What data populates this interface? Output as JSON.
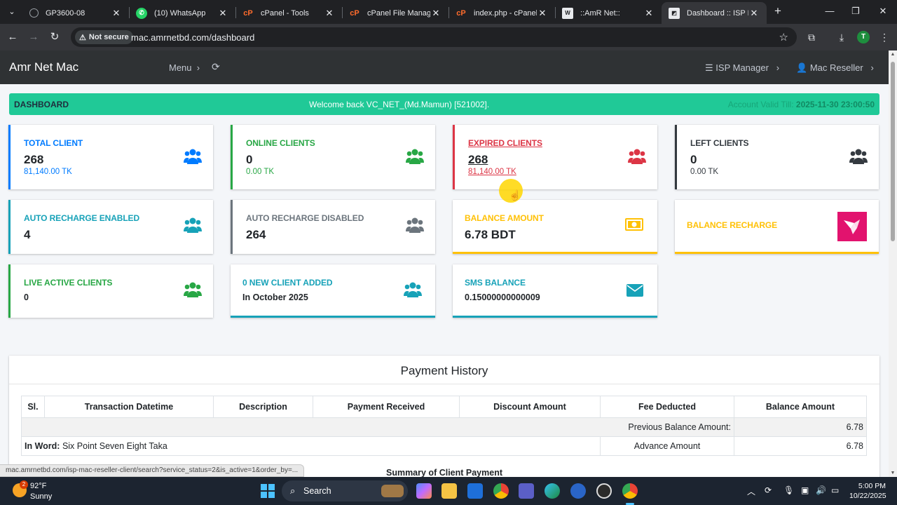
{
  "browser": {
    "tabs": [
      {
        "title": "GP3600-08",
        "favicon": "globe-icon",
        "active": false
      },
      {
        "title": "(10) WhatsApp",
        "favicon": "whatsapp-icon",
        "active": false
      },
      {
        "title": "cPanel - Tools",
        "favicon": "cpanel-icon",
        "active": false
      },
      {
        "title": "cPanel File Manager",
        "favicon": "cpanel-icon",
        "active": false
      },
      {
        "title": "index.php - cPanel Fi",
        "favicon": "cpanel-icon",
        "active": false
      },
      {
        "title": "::AmR Net::",
        "favicon": "site-icon",
        "active": false
      },
      {
        "title": "Dashboard :: ISP De",
        "favicon": "site-icon",
        "active": true
      }
    ],
    "security_label": "Not secure",
    "url": "mac.amrnetbd.com/dashboard",
    "profile_initial": "T",
    "status_url": "mac.amrnetbd.com/isp-mac-reseller-client/search?service_status=2&is_active=1&order_by=..."
  },
  "app": {
    "brand": "Amr Net Mac",
    "menu_label": "Menu",
    "isp_manager_label": "ISP Manager",
    "user_label": "Mac Reseller"
  },
  "welcome": {
    "section": "DASHBOARD",
    "message": "Welcome back VC_NET_(Md.Mamun) [521002].",
    "valid_label": "Account Valid Till:",
    "valid_date": "2025-11-30 23:00:50"
  },
  "cards": {
    "total_client": {
      "title": "TOTAL CLIENT",
      "value": "268",
      "amount": "81,140.00 TK"
    },
    "online_clients": {
      "title": "ONLINE CLIENTS",
      "value": "0",
      "amount": "0.00 TK"
    },
    "expired_clients": {
      "title": "EXPIRED CLIENTS",
      "value": "268",
      "amount": "81,140.00 TK"
    },
    "left_clients": {
      "title": "LEFT CLIENTS",
      "value": "0",
      "amount": "0.00 TK"
    },
    "auto_recharge_enabled": {
      "title": "AUTO RECHARGE ENABLED",
      "value": "4"
    },
    "auto_recharge_disabled": {
      "title": "AUTO RECHARGE DISABLED",
      "value": "264"
    },
    "balance_amount": {
      "title": "BALANCE AMOUNT",
      "value": "6.78 BDT"
    },
    "balance_recharge": {
      "title": "BALANCE RECHARGE"
    },
    "live_active_clients": {
      "title": "LIVE ACTIVE CLIENTS",
      "value": "0"
    },
    "new_client_added": {
      "title": "0 NEW CLIENT ADDED",
      "value": "In October 2025"
    },
    "sms_balance": {
      "title": "SMS BALANCE",
      "value": "0.15000000000009"
    }
  },
  "colors": {
    "blue": "#007bff",
    "green": "#28a745",
    "red": "#dc3545",
    "dark": "#343a40",
    "teal": "#17a2b8",
    "gray": "#6c757d",
    "yellow": "#ffc107",
    "success_bar": "#20c997",
    "bkash_pink": "#e2136e"
  },
  "payment_history": {
    "title": "Payment History",
    "columns": [
      "Sl.",
      "Transaction Datetime",
      "Description",
      "Payment Received",
      "Discount Amount",
      "Fee Deducted",
      "Balance Amount"
    ],
    "previous_balance_label": "Previous Balance Amount:",
    "previous_balance_value": "6.78",
    "in_word_label": "In Word:",
    "in_word_value": "Six Point Seven Eight Taka",
    "advance_label": "Advance Amount",
    "advance_value": "6.78",
    "summary_title": "Summary of Client Payment"
  },
  "taskbar": {
    "weather_badge": "2",
    "temperature": "92°F",
    "condition": "Sunny",
    "search_label": "Search",
    "time": "5:00 PM",
    "date": "10/22/2025"
  }
}
